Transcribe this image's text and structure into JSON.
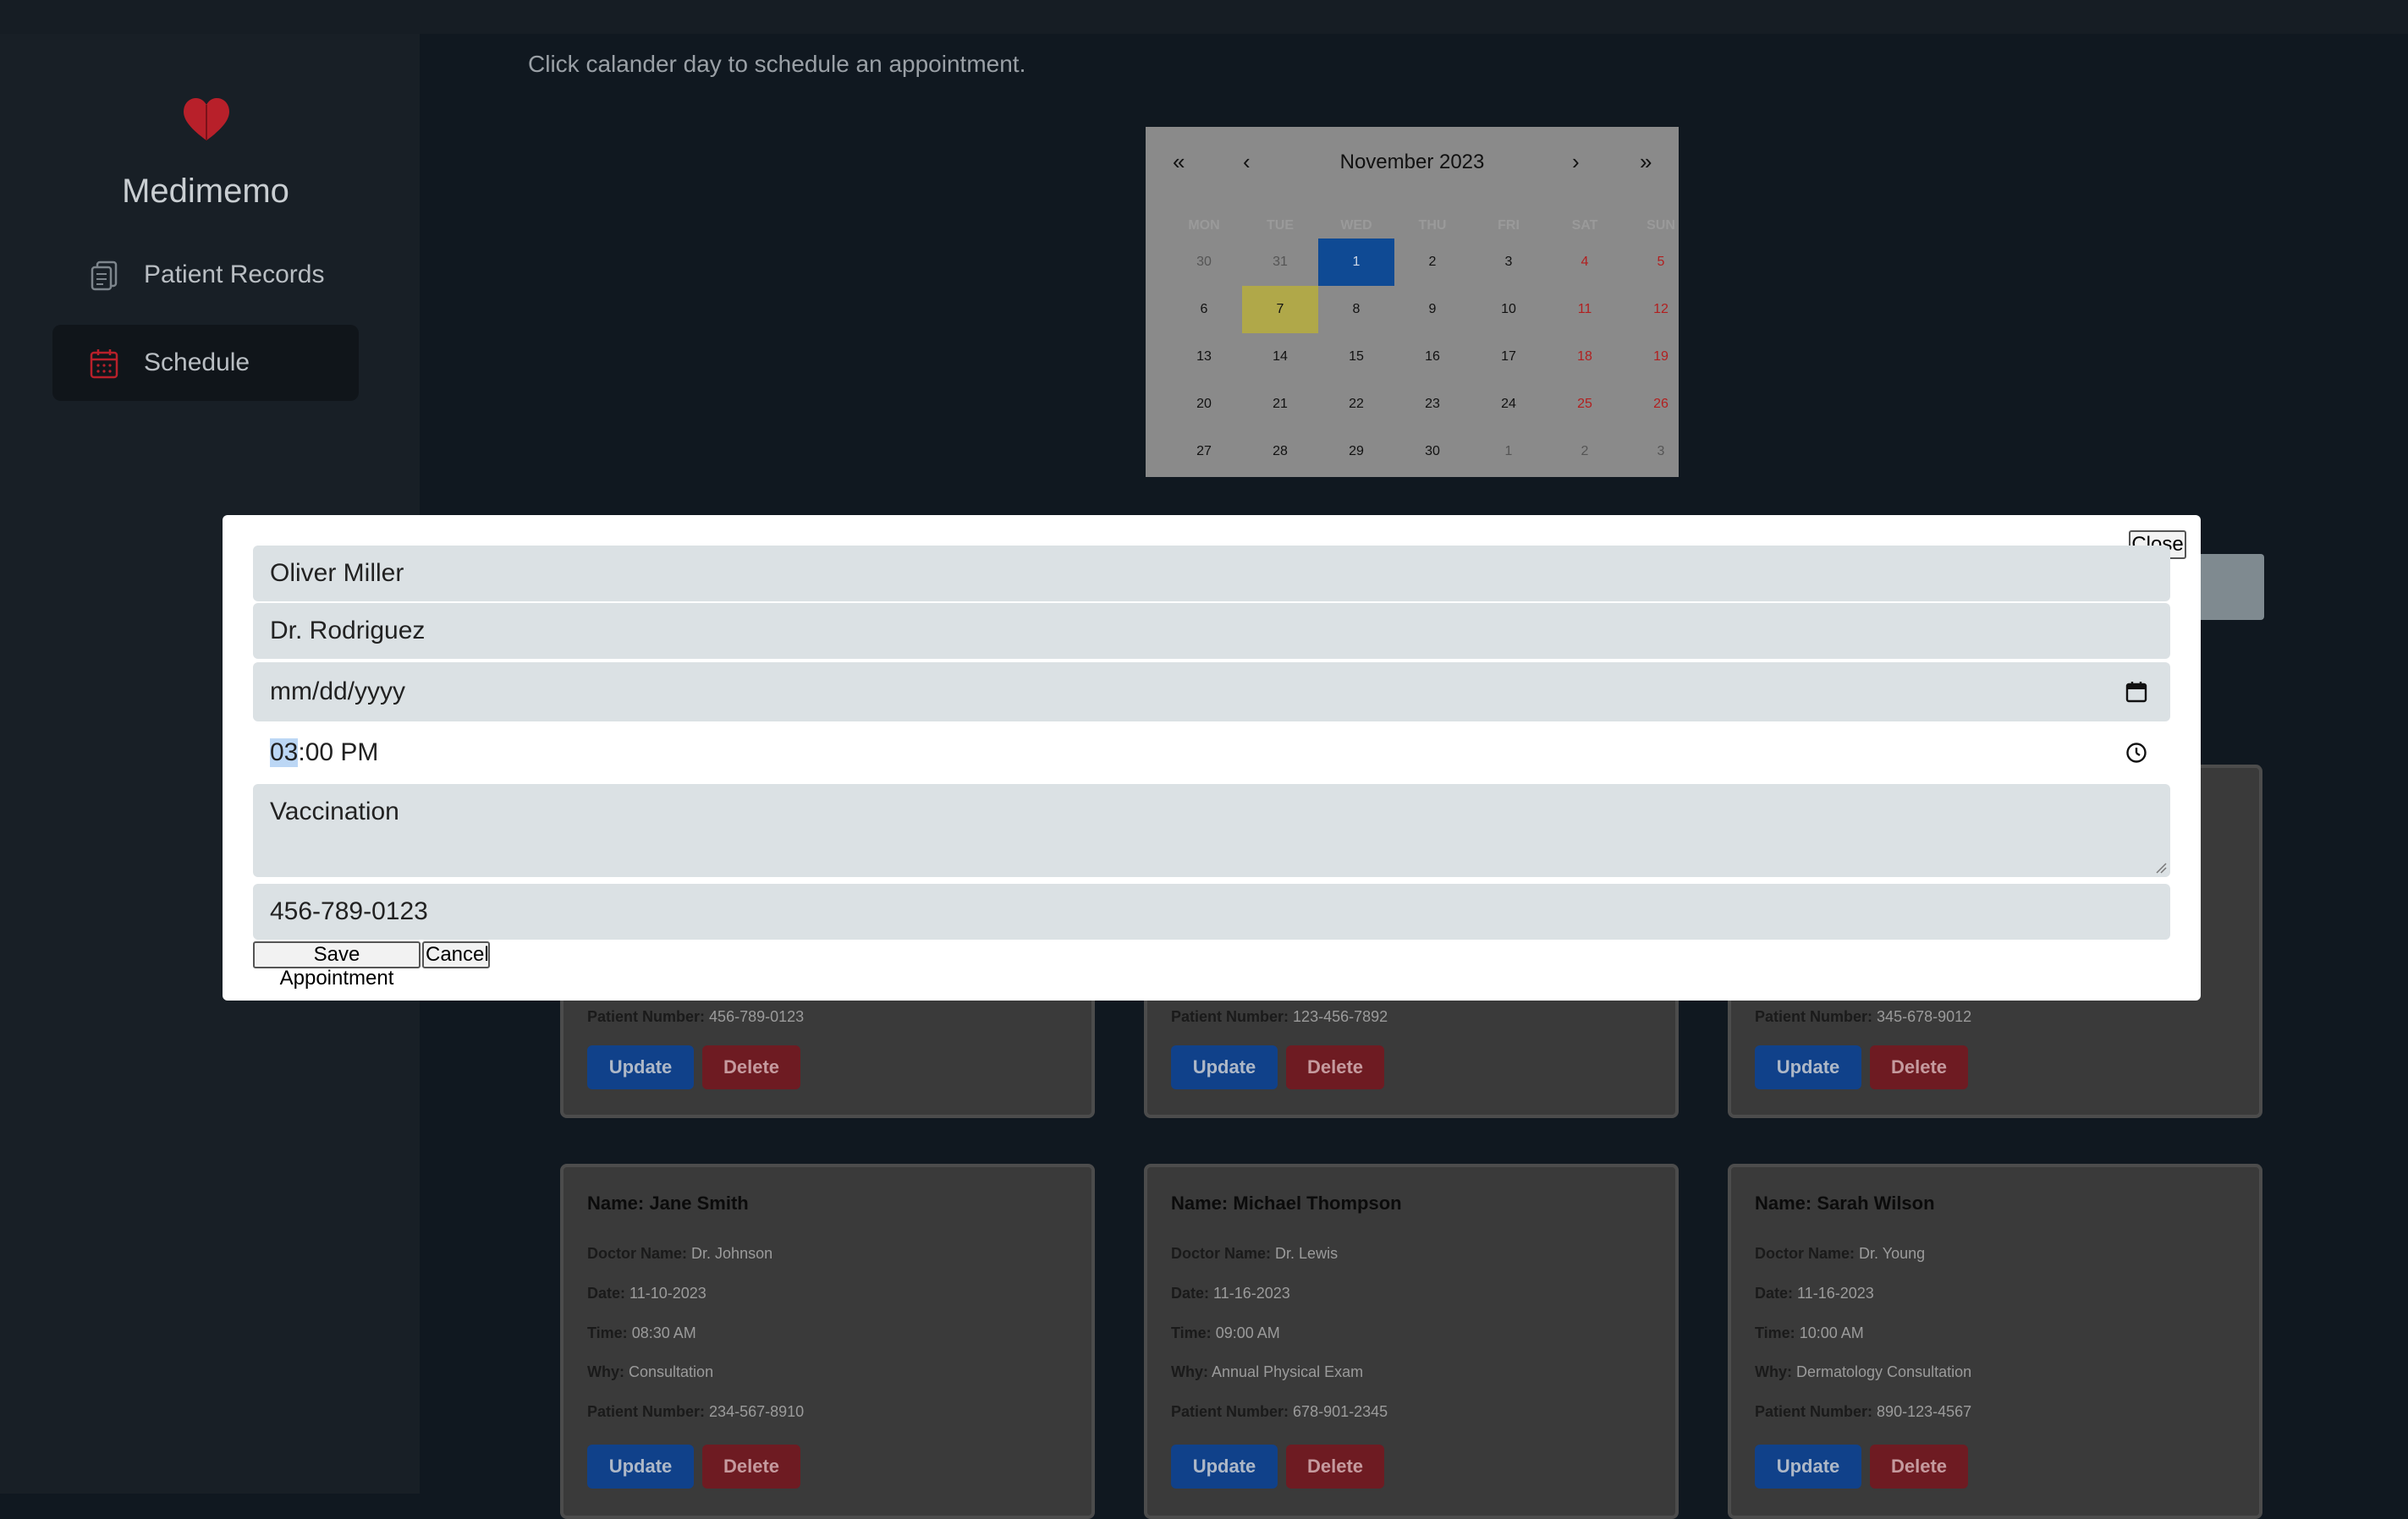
{
  "app": {
    "brand": "Medimemo",
    "colors": {
      "accent_red": "#b8202a",
      "selected_blue": "#0f4a94",
      "today_yellow": "#b0a849"
    }
  },
  "sidebar": {
    "items": [
      {
        "label": "Patient Records",
        "icon": "clipboard-icon",
        "active": false
      },
      {
        "label": "Schedule",
        "icon": "calendar-icon",
        "active": true
      }
    ]
  },
  "main": {
    "hint": "Click calander day to schedule an appointment."
  },
  "calendar": {
    "title": "November 2023",
    "nav": {
      "prev_year": "«",
      "prev_month": "‹",
      "next_month": "›",
      "next_year": "»"
    },
    "weekdays": [
      "MON",
      "TUE",
      "WED",
      "THU",
      "FRI",
      "SAT",
      "SUN"
    ],
    "weeks": [
      [
        "30",
        "31",
        "1",
        "2",
        "3",
        "4",
        "5"
      ],
      [
        "6",
        "7",
        "8",
        "9",
        "10",
        "11",
        "12"
      ],
      [
        "13",
        "14",
        "15",
        "16",
        "17",
        "18",
        "19"
      ],
      [
        "20",
        "21",
        "22",
        "23",
        "24",
        "25",
        "26"
      ],
      [
        "27",
        "28",
        "29",
        "30",
        "1",
        "2",
        "3"
      ]
    ],
    "selected_day": "1",
    "today": "7"
  },
  "modal": {
    "close_label": "Close",
    "patient_name": "Oliver Miller",
    "doctor_name": "Dr. Rodriguez",
    "date_placeholder": "mm/dd/yyyy",
    "time_hour": "03",
    "time_rest": ":00 PM",
    "reason": "Vaccination",
    "phone": "456-789-0123",
    "save_label": "Save Appointment",
    "cancel_label": "Cancel"
  },
  "cards": {
    "labels": {
      "name": "Name:",
      "doctor": "Doctor Name:",
      "date": "Date:",
      "time": "Time:",
      "why": "Why:",
      "patient_number": "Patient Number:",
      "update": "Update",
      "delete": "Delete"
    },
    "top_row": [
      {
        "patient_number": "456-789-0123"
      },
      {
        "patient_number": "123-456-7892"
      },
      {
        "patient_number": "345-678-9012"
      }
    ],
    "bottom_row": [
      {
        "name": "Jane Smith",
        "doctor": "Dr. Johnson",
        "date": "11-10-2023",
        "time": "08:30 AM",
        "why": "Consultation",
        "patient_number": "234-567-8910"
      },
      {
        "name": "Michael Thompson",
        "doctor": "Dr. Lewis",
        "date": "11-16-2023",
        "time": "09:00 AM",
        "why": "Annual Physical Exam",
        "patient_number": "678-901-2345"
      },
      {
        "name": "Sarah Wilson",
        "doctor": "Dr. Young",
        "date": "11-16-2023",
        "time": "10:00 AM",
        "why": "Dermatology Consultation",
        "patient_number": "890-123-4567"
      }
    ]
  }
}
